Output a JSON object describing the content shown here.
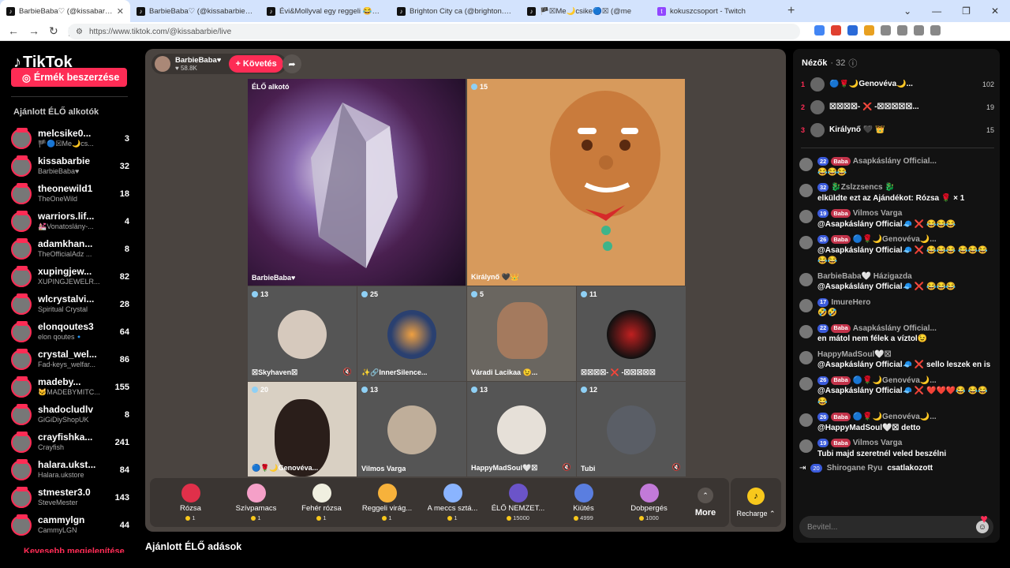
{
  "browser": {
    "tabs": [
      {
        "title": "BarbieBaba♡ (@kissabarbie",
        "active": true
      },
      {
        "title": "BarbieBaba♡ (@kissabarbie) ÉLŐ"
      },
      {
        "title": "Évi&Mollyval egy reggeli 😂😍 (@n"
      },
      {
        "title": "Brighton City ca (@brighton.city) ÉLŐ"
      },
      {
        "title": "🏴☒Me🌙csike🔵☒ (@me"
      },
      {
        "title": "kokuszcsoport - Twitch"
      }
    ],
    "url": "https://www.tiktok.com/@kissabarbie/live"
  },
  "sidebar": {
    "logo": "TikTok",
    "coins_button": "Érmék beszerzése",
    "section_title": "Ajánlott ÉLŐ alkotók",
    "creators": [
      {
        "name": "melcsike0...",
        "sub": "🏴🔵☒Me🌙cs...",
        "count": "3"
      },
      {
        "name": "kissabarbie",
        "sub": "BarbieBaba♥",
        "count": "32"
      },
      {
        "name": "theonewild1",
        "sub": "TheOneWild",
        "count": "18"
      },
      {
        "name": "warriors.lif...",
        "sub": "💒Vonatoslány-...",
        "count": "4"
      },
      {
        "name": "adamkhan...",
        "sub": "TheOfficialAdz ...",
        "count": "8"
      },
      {
        "name": "xupingjew...",
        "sub": "XUPINGJEWELR...",
        "count": "82"
      },
      {
        "name": "wlcrystalvi...",
        "sub": "Spiritual Crystal",
        "count": "28"
      },
      {
        "name": "elonqoutes3",
        "sub": "elon qoutes🔹",
        "count": "64"
      },
      {
        "name": "crystal_wel...",
        "sub": "Fad-keys_welfar...",
        "count": "86"
      },
      {
        "name": "madeby...",
        "sub": "🐱MADEBYMITC...",
        "count": "155"
      },
      {
        "name": "shadocludlv",
        "sub": "GiGiDiyShopUK",
        "count": "8"
      },
      {
        "name": "crayfishka...",
        "sub": "Crayfish",
        "count": "241"
      },
      {
        "name": "halara.ukst...",
        "sub": "Halara.ukstore",
        "count": "84"
      },
      {
        "name": "stmester3.0",
        "sub": "SteveMester",
        "count": "143"
      },
      {
        "name": "cammylgn",
        "sub": "CammyLGN",
        "count": "44"
      }
    ],
    "more_link": "Kevesebb megjelenítése"
  },
  "stage": {
    "host_name": "BarbieBaba♥",
    "host_likes": "♥ 58.8K",
    "follow_label": "+ Követés",
    "tiles": [
      {
        "label": "ÉLŐ alkotó",
        "name": "BarbieBaba♥"
      },
      {
        "viewers": "15",
        "name": "Királynő 🖤👑"
      },
      {
        "viewers": "13",
        "name": "☒Skyhaven☒"
      },
      {
        "viewers": "25",
        "name": "✨🔗InnerSilence..."
      },
      {
        "viewers": "5",
        "name": "Váradi Lacikaa 😉..."
      },
      {
        "viewers": "11",
        "name": "☒☒☒☒- ❌ -☒☒☒☒☒"
      },
      {
        "viewers": "20",
        "name": "🔵🌹🌙Genovéva..."
      },
      {
        "viewers": "13",
        "name": "Vilmos Varga"
      },
      {
        "viewers": "13",
        "name": "HappyMadSoul🤍☒"
      },
      {
        "viewers": "12",
        "name": "Tubi"
      }
    ],
    "gifts": [
      {
        "name": "Rózsa",
        "price": "1",
        "color": "#e0304a"
      },
      {
        "name": "Szívpamacs",
        "price": "1",
        "color": "#f5a0c8"
      },
      {
        "name": "Fehér rózsa",
        "price": "1",
        "color": "#f0efe0"
      },
      {
        "name": "Reggeli virág...",
        "price": "1",
        "color": "#f7b23b"
      },
      {
        "name": "A meccs sztá...",
        "price": "1",
        "color": "#8ab4ff"
      },
      {
        "name": "ÉLŐ NEMZET...",
        "price": "15000",
        "color": "#6b54c9"
      },
      {
        "name": "Kiütés",
        "price": "4999",
        "color": "#5a7ee0"
      },
      {
        "name": "Dobpergés",
        "price": "1000",
        "color": "#c27ad8"
      }
    ],
    "more_label": "More",
    "recharge_label": "Recharge ⌃"
  },
  "recommended_title": "Ajánlott ÉLŐ adások",
  "chat": {
    "viewers_title": "Nézők",
    "viewers_count": "· 32",
    "top_viewers": [
      {
        "rank": "1",
        "name": "🔵🌹🌙Genovéva🌙...",
        "score": "102"
      },
      {
        "rank": "2",
        "name": "☒☒☒☒- ❌ -☒☒☒☒☒...",
        "score": "19"
      },
      {
        "rank": "3",
        "name": "Királynő 🖤 👑",
        "score": "15"
      }
    ],
    "messages": [
      {
        "level": "22",
        "fan": "Baba",
        "user": "Asapkáslány Official...",
        "text": "😂😂😂"
      },
      {
        "level": "32",
        "fan": "",
        "user": "🐉Zslzzsencs 🐉",
        "text": "elküldte ezt az Ajándékot: Rózsa 🌹 × 1"
      },
      {
        "level": "19",
        "fan": "Baba",
        "user": "Vilmos Varga",
        "text": "@Asapkáslány Official🧢 ❌ 😂😂😂"
      },
      {
        "level": "26",
        "fan": "Baba",
        "user": "🔵🌹🌙Genovéva🌙...",
        "text": "@Asapkáslány Official🧢 ❌ 😂😂😂 😂😂😂😂😂"
      },
      {
        "level": "",
        "fan": "",
        "user": "BarbieBaba🤍 Házigazda",
        "text": "@Asapkáslány Official🧢 ❌ 😂😂😂"
      },
      {
        "level": "17",
        "fan": "",
        "user": "ImureHero",
        "text": "🤣🤣"
      },
      {
        "level": "22",
        "fan": "Baba",
        "user": "Asapkáslány Official...",
        "text": "en mátol nem félek a víztol😉"
      },
      {
        "level": "",
        "fan": "",
        "user": "HappyMadSoul🤍☒",
        "text": "@Asapkáslány Official🧢 ❌ sello leszek en is"
      },
      {
        "level": "26",
        "fan": "Baba",
        "user": "🔵🌹🌙Genovéva🌙...",
        "text": "@Asapkáslány Official🧢 ❌ ❤️❤️❤️😂 😂😂😂"
      },
      {
        "level": "26",
        "fan": "Baba",
        "user": "🔵🌹🌙Genovéva🌙...",
        "text": "@HappyMadSoul🤍☒ detto"
      },
      {
        "level": "19",
        "fan": "Baba",
        "user": "Vilmos Varga",
        "text": "Tubi majd szeretnél veled beszélni"
      }
    ],
    "joined": {
      "level": "20",
      "user": "Shirogane Ryu",
      "text": "csatlakozott"
    },
    "input_placeholder": "Bevitel..."
  }
}
